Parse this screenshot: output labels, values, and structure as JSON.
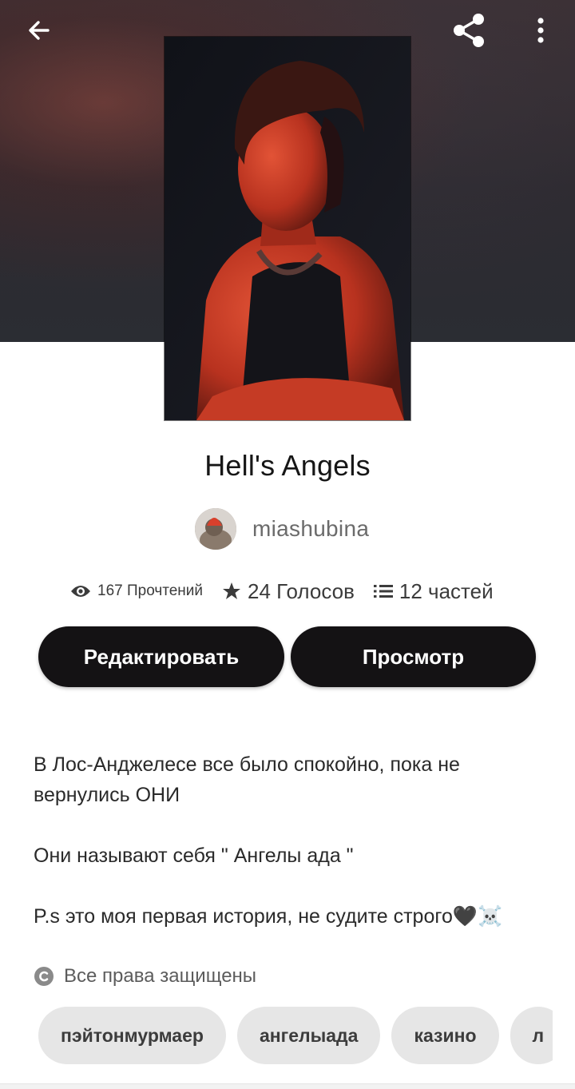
{
  "story": {
    "title": "Hell's Angels",
    "author": "miashubina"
  },
  "stats": {
    "reads": "167 Прочтений",
    "votes": "24 Голосов",
    "parts": "12 частей"
  },
  "actions": {
    "edit_label": "Редактировать",
    "preview_label": "Просмотр"
  },
  "description": {
    "line1": "В Лос-Анджелесе все было спокойно, пока не вернулись ОНИ",
    "line2": "Они называют себя \" Ангелы ада \"",
    "line3": "P.s это моя первая история, не судите строго🖤☠️"
  },
  "copyright": "Все права защищены",
  "tags": [
    "пэйтонмурмаер",
    "ангелыада",
    "казино",
    "л"
  ],
  "icons": {
    "back": "arrow-left-icon",
    "share": "share-icon",
    "more": "more-vertical-icon",
    "reads": "eye-icon",
    "votes": "star-icon",
    "parts": "list-icon",
    "copyright": "copyright-icon"
  },
  "colors": {
    "button_bg": "#141214",
    "tag_bg": "#e6e6e6",
    "cover_accent": "#d8402c"
  }
}
